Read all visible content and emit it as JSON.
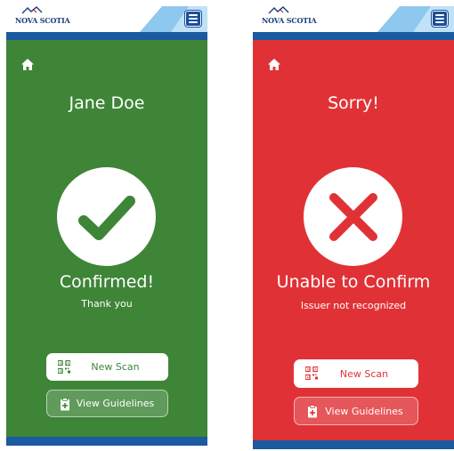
{
  "brand": {
    "logo_text": "NOVA SCOTIA"
  },
  "colors": {
    "success_bg": "#3e8537",
    "error_bg": "#e03236",
    "header_bar": "#1a5aa0",
    "success_icon": "#3e8537",
    "error_icon": "#e03236"
  },
  "screens": [
    {
      "state": "success",
      "title": "Jane Doe",
      "status": "Confirmed!",
      "message": "Thank you",
      "icon": "checkmark-icon",
      "primary_button": "New Scan",
      "secondary_button": "View Guidelines"
    },
    {
      "state": "error",
      "title": "Sorry!",
      "status": "Unable to Confirm",
      "message": "Issuer not recognized",
      "icon": "x-mark-icon",
      "primary_button": "New Scan",
      "secondary_button": "View Guidelines"
    }
  ]
}
